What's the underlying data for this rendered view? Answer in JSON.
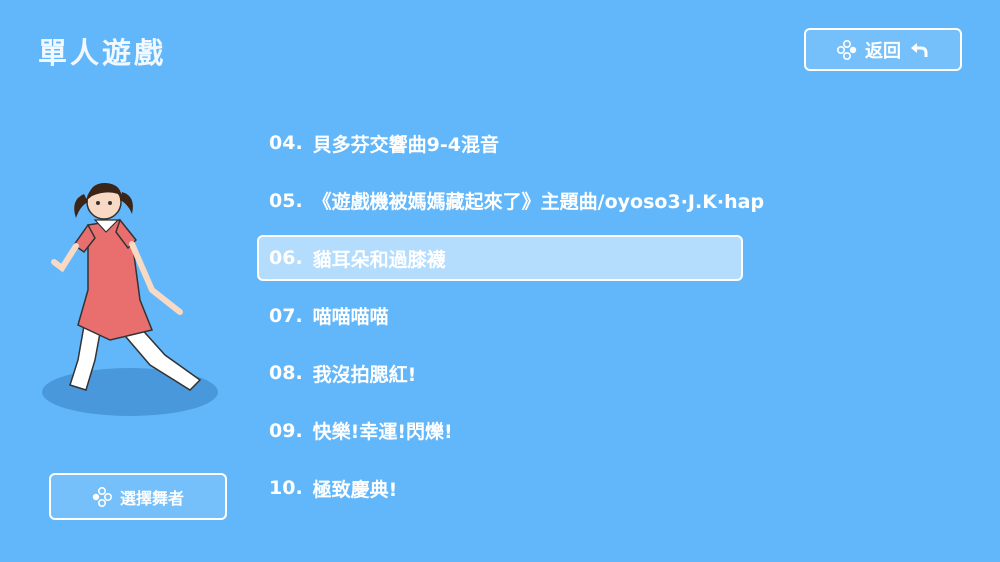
{
  "header": {
    "title": "單人遊戲",
    "back_label": "返回"
  },
  "songs": [
    {
      "num": "04.",
      "title": "貝多芬交響曲9-4混音"
    },
    {
      "num": "05.",
      "title": "《遊戲機被媽媽藏起來了》主題曲/oyoso3·J.K·hap"
    },
    {
      "num": "06.",
      "title": "貓耳朵和過膝襪"
    },
    {
      "num": "07.",
      "title": "喵喵喵喵"
    },
    {
      "num": "08.",
      "title": "我沒拍腮紅!"
    },
    {
      "num": "09.",
      "title": "快樂!幸運!閃爍!"
    },
    {
      "num": "10.",
      "title": "極致慶典!"
    }
  ],
  "selected_index": 2,
  "footer": {
    "select_dancer_label": "選擇舞者"
  },
  "icons": {
    "controller": "gamepad-buttons-icon",
    "back": "return-arrow-icon"
  },
  "colors": {
    "background": "#62b7fb",
    "selected_row": "#b3dcfd",
    "dancer_dress": "#e96f6f",
    "shadow": "#4a98dc"
  }
}
